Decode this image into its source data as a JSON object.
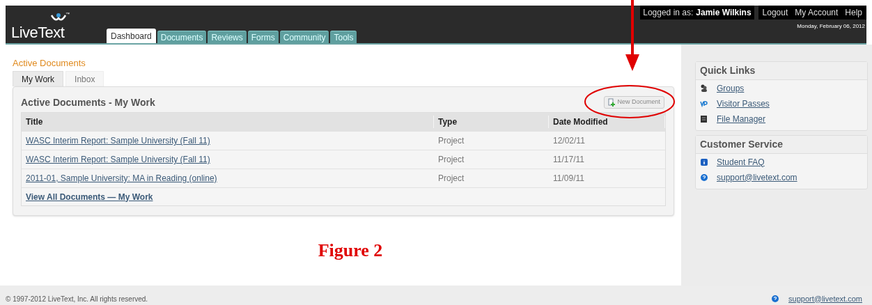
{
  "header": {
    "logo": "LiveText",
    "logo_mark": "™",
    "login_label": "Logged in as:",
    "user": "Jamie Wilkins",
    "links": [
      "Logout",
      "My Account",
      "Help"
    ],
    "date": "Monday, February 06, 2012"
  },
  "nav_tabs": [
    {
      "label": "Dashboard",
      "selected": true
    },
    {
      "label": "Documents",
      "selected": false
    },
    {
      "label": "Reviews",
      "selected": false
    },
    {
      "label": "Forms",
      "selected": false
    },
    {
      "label": "Community",
      "selected": false
    },
    {
      "label": "Tools",
      "selected": false
    }
  ],
  "section_title": "Active Documents",
  "sub_tabs": [
    {
      "label": "My Work",
      "selected": true
    },
    {
      "label": "Inbox",
      "selected": false
    }
  ],
  "panel": {
    "title": "Active Documents - My Work",
    "new_button": "New Document",
    "columns": [
      "Title",
      "Type",
      "Date Modified"
    ],
    "rows": [
      {
        "title": "WASC Interim Report: Sample University (Fall 11)",
        "type": "Project",
        "date": "12/02/11"
      },
      {
        "title": "WASC Interim Report: Sample University (Fall 11)",
        "type": "Project",
        "date": "11/17/11"
      },
      {
        "title": "2011-01, Sample University: MA in Reading (online)",
        "type": "Project",
        "date": "11/09/11"
      }
    ],
    "view_all": "View All Documents — My Work"
  },
  "quick_links": {
    "title": "Quick Links",
    "items": [
      "Groups",
      "Visitor Passes",
      "File Manager"
    ]
  },
  "customer_service": {
    "title": "Customer Service",
    "items": [
      "Student FAQ",
      "support@livetext.com"
    ]
  },
  "annotation": {
    "caption": "Figure 2"
  },
  "footer": {
    "copyright": "© 1997-2012 LiveText, Inc. All rights reserved.",
    "email": "support@livetext.com"
  }
}
